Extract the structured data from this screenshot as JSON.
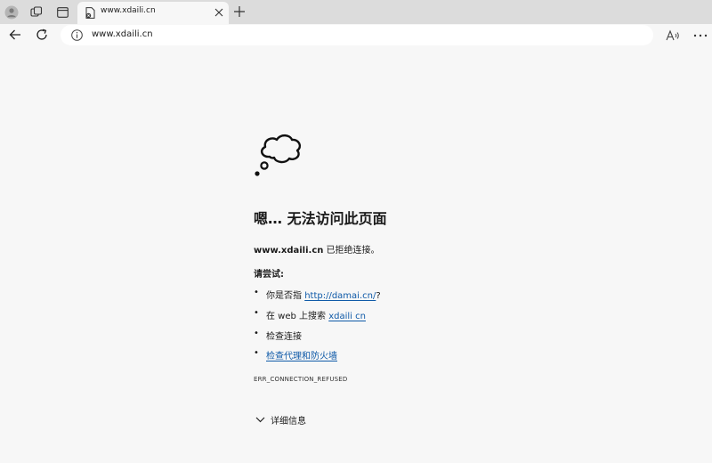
{
  "browser": {
    "tab": {
      "title": "www.xdaili.cn"
    },
    "address": {
      "url": "www.xdaili.cn"
    }
  },
  "error_page": {
    "heading": "嗯… 无法访问此页面",
    "refused_host": "www.xdaili.cn",
    "refused_text": " 已拒绝连接。",
    "try_label": "请尝试:",
    "suggestions": [
      {
        "prefix": "你是否指 ",
        "link": "http://damai.cn/",
        "suffix": "?"
      },
      {
        "prefix": "在 web 上搜索 ",
        "link": "xdaili cn",
        "suffix": ""
      },
      {
        "text": "检查连接"
      },
      {
        "link": "检查代理和防火墙"
      }
    ],
    "bullet": "•",
    "error_code": "ERR_CONNECTION_REFUSED",
    "details_label": "详细信息"
  },
  "icons": {
    "profile": "profile-icon",
    "collections": "collections-icon",
    "tab_actions": "tab-actions-icon",
    "favicon": "page-error-favicon",
    "close": "close-icon",
    "new_tab": "plus-icon",
    "back": "arrow-left-icon",
    "reload": "reload-icon",
    "info": "info-icon",
    "read_aloud": "read-aloud-icon",
    "more": "more-icon",
    "cloud": "thought-cloud-icon",
    "chevron": "chevron-down-icon"
  },
  "colors": {
    "link": "#0f5aa8",
    "tabstrip": "#dcdcdc",
    "page_bg": "#f7f7f7"
  }
}
